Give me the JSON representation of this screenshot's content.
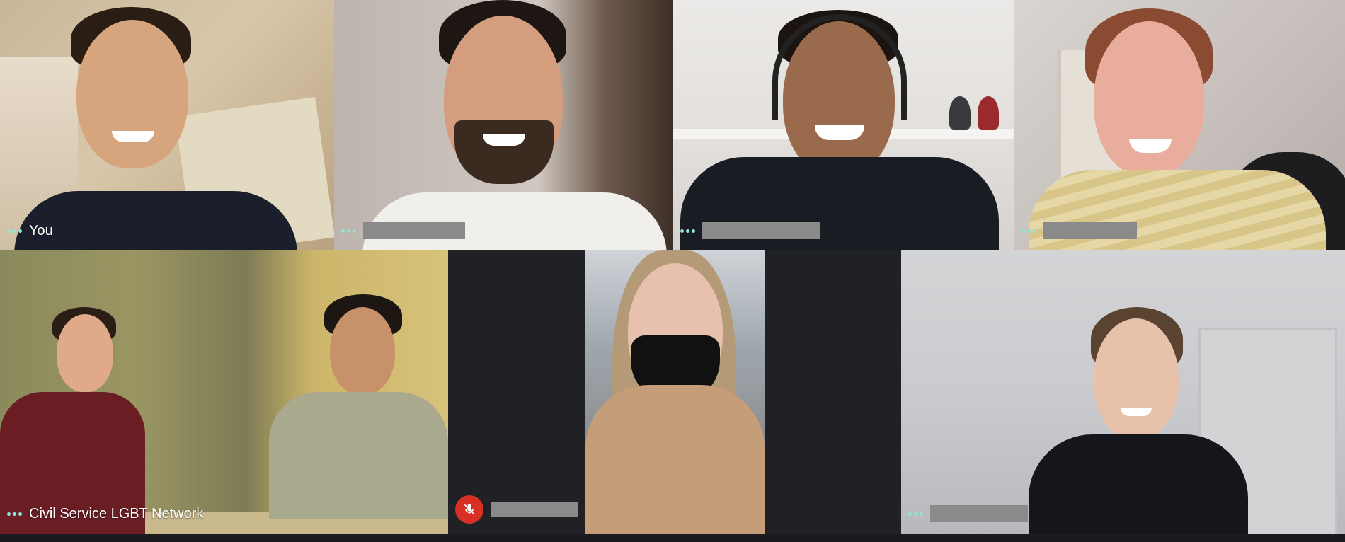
{
  "participants": [
    {
      "id": "you",
      "name": "You",
      "redacted": false
    },
    {
      "id": "p2",
      "name": "",
      "redacted": true
    },
    {
      "id": "p3",
      "name": "",
      "redacted": true
    },
    {
      "id": "p4",
      "name": "",
      "redacted": true
    },
    {
      "id": "lgbt",
      "name": "Civil Service LGBT Network",
      "redacted": false
    },
    {
      "id": "p6",
      "name": "",
      "redacted": true,
      "muted": true
    },
    {
      "id": "p7",
      "name": "",
      "redacted": true
    }
  ],
  "colors": {
    "background": "#202124",
    "more_options_dots": "#8ee6d6",
    "mic_off": "#d93025",
    "redaction": "#8a8a8a"
  },
  "icons": {
    "more_options": "more-options-icon",
    "mic_off": "mic-off-icon"
  }
}
